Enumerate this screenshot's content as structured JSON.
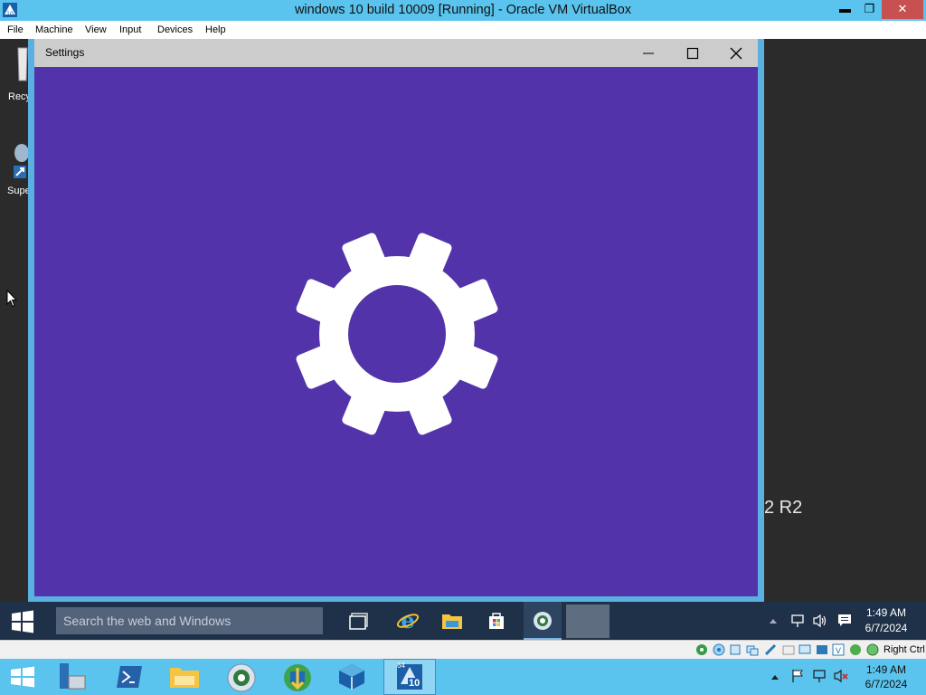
{
  "vbox": {
    "title": "windows 10 build 10009 [Running] - Oracle VM VirtualBox",
    "controls": {
      "minimize": "▬",
      "maximize": "❐",
      "close": "✕"
    },
    "menu": [
      "File",
      "Machine",
      "View",
      "Input",
      "Devices",
      "Help"
    ],
    "status": {
      "host_key": "Right Ctrl"
    }
  },
  "desktop": {
    "icons": [
      {
        "label": "Recy"
      },
      {
        "label": "Supe"
      }
    ],
    "background_text": "2 R2"
  },
  "settings": {
    "title": "Settings",
    "icon": "gear-icon",
    "accent": "#5233aa"
  },
  "guest_taskbar": {
    "search_placeholder": "Search the web and Windows",
    "time": "1:49 AM",
    "date": "6/7/2024"
  },
  "host_taskbar": {
    "time": "1:49 AM",
    "date": "6/7/2024",
    "vm_badge": "10",
    "vm_bits": "64"
  }
}
